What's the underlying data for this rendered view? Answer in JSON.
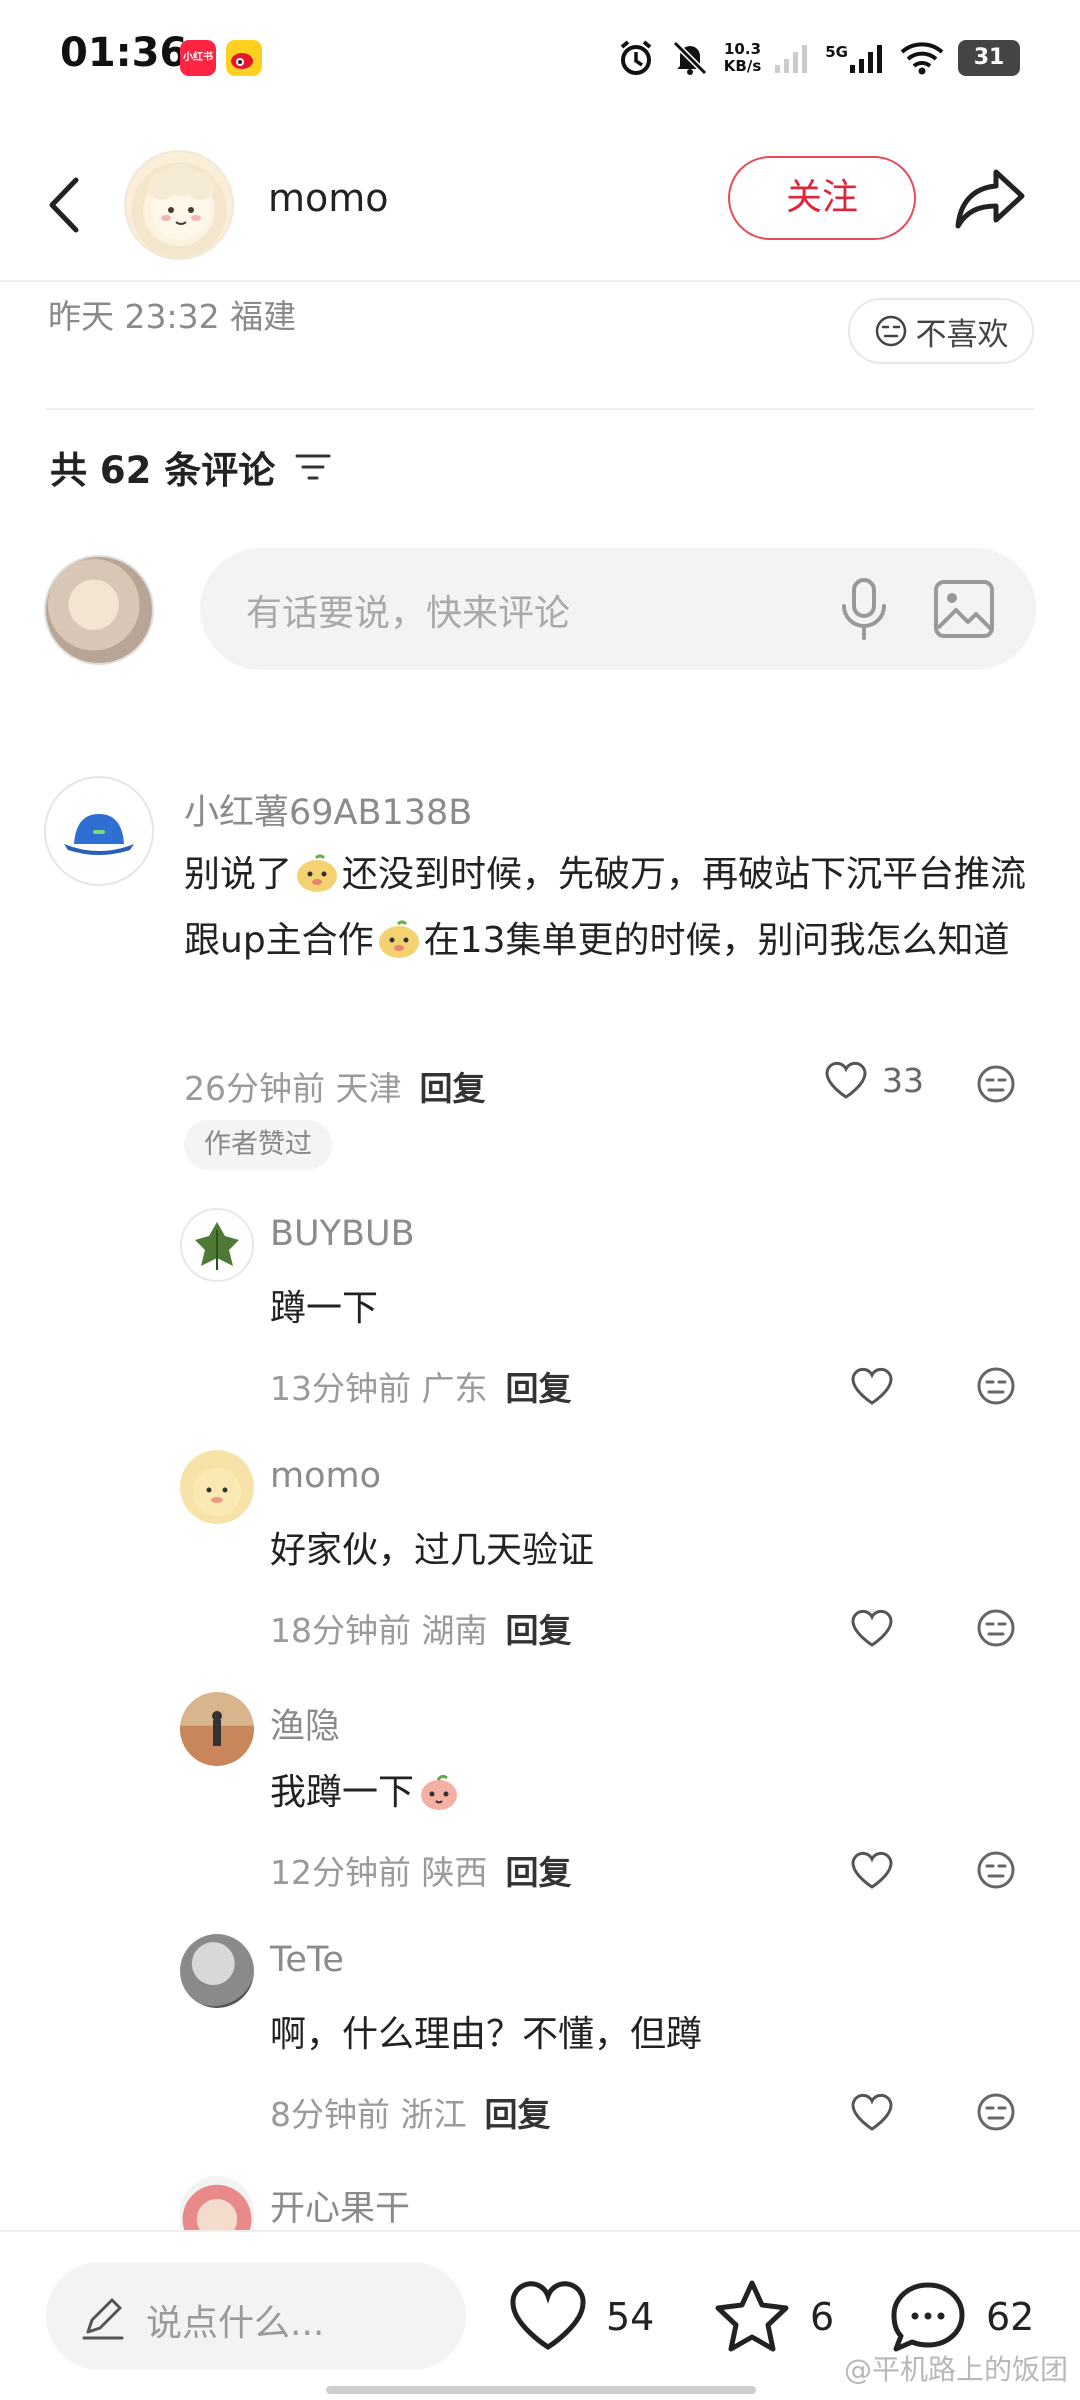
{
  "status_bar": {
    "time": "01:36",
    "app_icon_1_label": "小红书",
    "net_speed_value": "10.3",
    "net_speed_unit": "KB/s",
    "network": "5G",
    "battery": "31"
  },
  "header": {
    "author_name": "momo",
    "follow_label": "关注"
  },
  "post": {
    "time_location": "昨天 23:32 福建",
    "dislike_label": "不喜欢"
  },
  "comments_section": {
    "count_label": "共 62 条评论",
    "input_placeholder": "有话要说，快来评论"
  },
  "comments": [
    {
      "user": "小红薯69AB138B",
      "text_part1": "别说了",
      "text_part2": "还没到时候，先破万，再破站下沉平台推流跟up主合作",
      "text_part3": "在13集单更的时候，别问我怎么知道",
      "meta": "26分钟前 天津",
      "reply": "回复",
      "likes": "33",
      "badge": "作者赞过"
    }
  ],
  "replies": [
    {
      "user": "BUYBUB",
      "text": "蹲一下",
      "meta": "13分钟前 广东",
      "reply": "回复"
    },
    {
      "user": "momo",
      "text": "好家伙，过几天验证",
      "meta": "18分钟前 湖南",
      "reply": "回复"
    },
    {
      "user": "渔隐",
      "text": "我蹲一下",
      "meta": "12分钟前 陕西",
      "reply": "回复"
    },
    {
      "user": "TeTe",
      "text": "啊，什么理由？不懂，但蹲",
      "meta": "8分钟前 浙江",
      "reply": "回复"
    },
    {
      "user": "开心果干"
    }
  ],
  "bottom_bar": {
    "input_placeholder": "说点什么...",
    "likes": "54",
    "favorites": "6",
    "comments": "62",
    "watermark": "@平机路上的饭团"
  },
  "icons": {
    "back": "chevron-left-icon",
    "share": "share-arrow-icon",
    "mic": "microphone-icon",
    "image": "image-icon",
    "heart": "heart-icon",
    "star": "star-icon",
    "comment": "comment-bubble-icon",
    "dislike": "meh-face-icon",
    "sort": "sort-filter-icon",
    "pen": "pen-icon"
  },
  "colors": {
    "accent_red": "#e0243a",
    "text_primary": "#222222",
    "text_secondary": "#8b8b8b",
    "input_bg": "#f3f3f5"
  }
}
